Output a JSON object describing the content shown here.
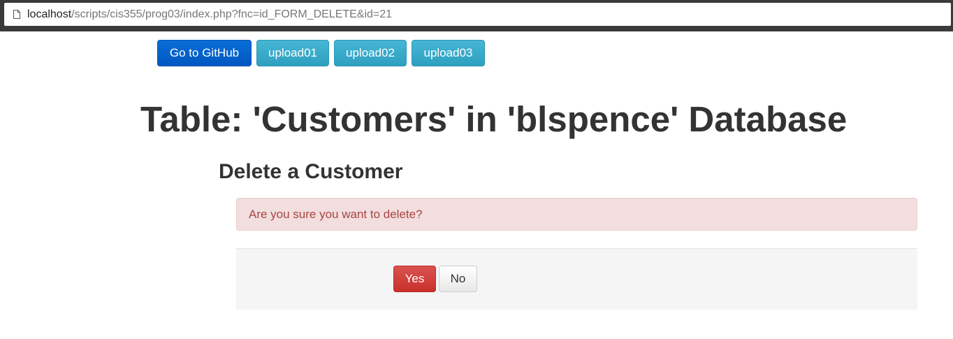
{
  "browser": {
    "url_host": "localhost",
    "url_path": "/scripts/cis355/prog03/index.php?fnc=id_FORM_DELETE&id=21",
    "page_icon": "document-icon"
  },
  "nav": {
    "github_label": "Go to GitHub",
    "upload01_label": "upload01",
    "upload02_label": "upload02",
    "upload03_label": "upload03"
  },
  "main": {
    "title": "Table: 'Customers' in 'blspence' Database",
    "subtitle": "Delete a Customer",
    "alert_text": "Are you sure you want to delete?",
    "yes_label": "Yes",
    "no_label": "No"
  },
  "colors": {
    "primary": "#0057c2",
    "info": "#31a2c3",
    "danger": "#d9534f",
    "alert_bg": "#f2dede",
    "alert_text": "#a94442"
  }
}
